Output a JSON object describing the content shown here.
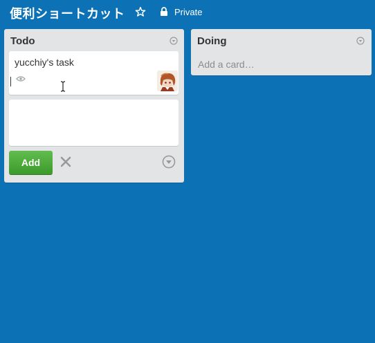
{
  "board": {
    "title": "便利ショートカット",
    "privacy": "Private",
    "star_icon": "star-icon",
    "lock_icon": "lock-icon",
    "background_color": "#0c71b5"
  },
  "lists": {
    "todo": {
      "title": "Todo",
      "cards": [
        {
          "title": "yucchiy's task",
          "badges": [
            "eye-icon"
          ],
          "member": "avatar"
        }
      ],
      "composer": {
        "value": "",
        "add_label": "Add"
      }
    },
    "doing": {
      "title": "Doing",
      "add_card_label": "Add a card…"
    }
  },
  "colors": {
    "add_button": "#5aac44",
    "list_bg": "#e2e4e6",
    "card_bg": "#ffffff"
  }
}
